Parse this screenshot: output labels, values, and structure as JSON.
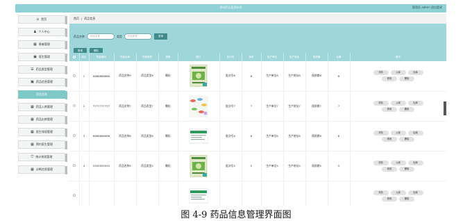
{
  "header": {
    "title": "基础药品管理系统",
    "user": "管理员 admin  退出登录"
  },
  "sidebar": [
    {
      "label": "首页",
      "icon": "home-icon",
      "glyph": "⌂"
    },
    {
      "label": "个人中心",
      "icon": "user-icon",
      "glyph": "♟"
    },
    {
      "label": "患者管理",
      "icon": "grid-icon",
      "glyph": "▦"
    },
    {
      "label": "医生管理",
      "icon": "doc-icon",
      "glyph": "▣"
    },
    {
      "label": "药品类型管理",
      "icon": "list-icon",
      "glyph": "☰"
    },
    {
      "label": "药品信息管理",
      "icon": "doc-icon",
      "glyph": "▣"
    },
    {
      "label": "药品信息",
      "icon": "",
      "glyph": ""
    },
    {
      "label": "药品入库管理",
      "icon": "grid-icon",
      "glyph": "▦"
    },
    {
      "label": "药品出库管理",
      "icon": "grid-icon",
      "glyph": "▦"
    },
    {
      "label": "医生排班管理",
      "icon": "grid-icon",
      "glyph": "▦"
    },
    {
      "label": "预约医生管理",
      "icon": "grid-icon",
      "glyph": "▦"
    },
    {
      "label": "统计排班管理",
      "icon": "shield-icon",
      "glyph": "⛉"
    },
    {
      "label": "诊断信息管理",
      "icon": "grid-icon",
      "glyph": "▦"
    }
  ],
  "breadcrumb": {
    "home": "首页",
    "sep": "/",
    "current": "药品信息"
  },
  "search": {
    "name_label": "药品名称",
    "name_placeholder": "药品名称",
    "type_label": "类型",
    "type_placeholder": "药品类型",
    "search_button": "查询",
    "add_button": "新增",
    "delete_button": "删除"
  },
  "table": {
    "columns": [
      "",
      "索引",
      "药品编号",
      "药品名称",
      "药品类型",
      "规格",
      "图片",
      "批次号",
      "库存",
      "生产单位",
      "生产地址",
      "保质期",
      "价格",
      "操作"
    ],
    "rows": [
      {
        "index": "1",
        "code": "8888888888",
        "name": "药品名称9",
        "type": "药品类型8",
        "spec": "颗粒",
        "image": "green-box",
        "batch": "批次号8",
        "stock": "8",
        "maker": "生产单位8",
        "address": "生产地址8",
        "shelf": "保质期8",
        "price": "8"
      },
      {
        "index": "2",
        "code": "7777777777",
        "name": "药品名称7",
        "type": "药品类型7",
        "spec": "颗粒",
        "image": "pills",
        "batch": "批次号7",
        "stock": "7",
        "maker": "生产单位7",
        "address": "生产地址7",
        "shelf": "保质期7",
        "price": "7"
      },
      {
        "index": "3",
        "code": "6666666666",
        "name": "药品名称6",
        "type": "药品类型6",
        "spec": "颗粒",
        "image": "blister",
        "batch": "批次号6",
        "stock": "6",
        "maker": "生产单位6",
        "address": "生产地址6",
        "shelf": "保质期6",
        "price": "6"
      },
      {
        "index": "4",
        "code": "5555555555",
        "name": "药品名称5",
        "type": "药品类型5",
        "spec": "颗粒",
        "image": "green-box",
        "batch": "批次号5",
        "stock": "5",
        "maker": "生产单位5",
        "address": "生产地址5",
        "shelf": "保质期5",
        "price": "5"
      },
      {
        "index": "",
        "code": "",
        "name": "",
        "type": "",
        "spec": "",
        "image": "blister",
        "batch": "",
        "stock": "",
        "maker": "",
        "address": "",
        "shelf": "",
        "price": ""
      }
    ],
    "ops": [
      "详情",
      "入库",
      "出库",
      "修改",
      "删除"
    ]
  },
  "caption": "图 4-9 药品信息管理界面图",
  "colors": {
    "header": "#8fd1d6",
    "accent": "#9fd6da",
    "active": "#7fc8c8",
    "button": "#3e8a8d"
  }
}
